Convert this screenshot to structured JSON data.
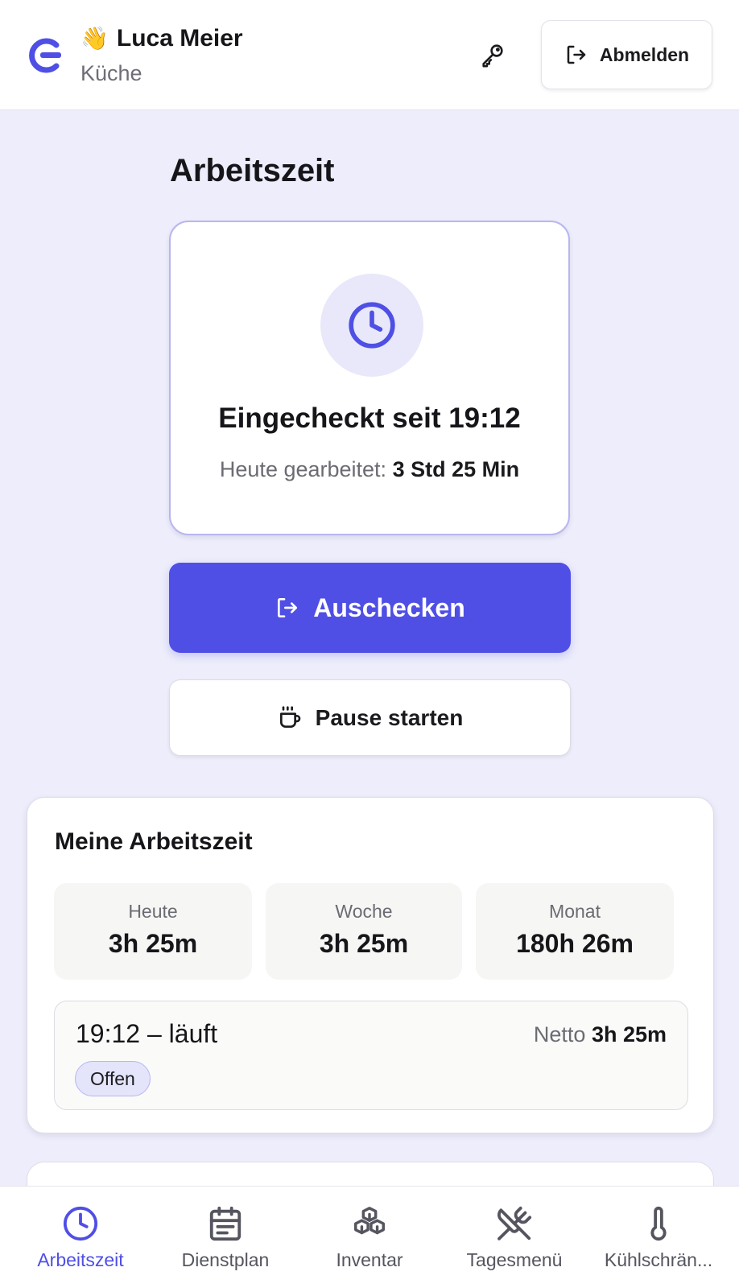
{
  "header": {
    "user_emoji": "👋",
    "user_name": "Luca Meier",
    "department": "Küche",
    "logout_label": "Abmelden"
  },
  "main": {
    "section_title": "Arbeitszeit",
    "status_text": "Eingecheckt seit 19:12",
    "worked_label": "Heute gearbeitet:",
    "worked_value": "3 Std 25 Min",
    "checkout_label": "Auschecken",
    "pause_label": "Pause starten"
  },
  "summary": {
    "title": "Meine Arbeitszeit",
    "stats": [
      {
        "label": "Heute",
        "value": "3h 25m"
      },
      {
        "label": "Woche",
        "value": "3h 25m"
      },
      {
        "label": "Monat",
        "value": "180h 26m"
      }
    ],
    "entry": {
      "time": "19:12 – läuft",
      "netto_label": "Netto",
      "netto_value": "3h 25m",
      "badge": "Offen"
    }
  },
  "nav": {
    "items": [
      {
        "label": "Arbeitszeit",
        "icon": "clock-icon",
        "active": true
      },
      {
        "label": "Dienstplan",
        "icon": "calendar-icon",
        "active": false
      },
      {
        "label": "Inventar",
        "icon": "boxes-icon",
        "active": false
      },
      {
        "label": "Tagesmenü",
        "icon": "utensils-crossed-icon",
        "active": false
      },
      {
        "label": "Kühlschrän...",
        "icon": "thermometer-icon",
        "active": false
      }
    ]
  },
  "colors": {
    "accent": "#4f4fe6",
    "background": "#ededfb",
    "card_border": "#b8b6f0"
  }
}
